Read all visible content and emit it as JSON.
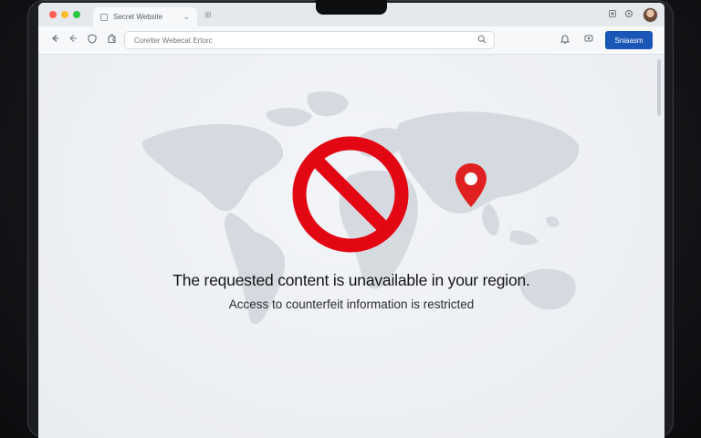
{
  "browser": {
    "tab": {
      "title": "Secret Website",
      "close_glyph": "⌄"
    },
    "new_tab_glyph": "⊞",
    "address_bar": {
      "value": "",
      "placeholder": "Corelter Webecat Ertorc"
    },
    "sign_in_label": "Sniaasm",
    "icons": [
      "back-icon",
      "forward-icon",
      "extension-icon",
      "settings-icon",
      "search-icon",
      "bell-icon",
      "account-icon"
    ],
    "accent_color": "#1a56b8"
  },
  "page": {
    "headline": "The requested content is unavailable in your region.",
    "subline": "Access to counterfeit information is restricted",
    "sign_color": "#e30613",
    "pin_color": "#e02020"
  }
}
